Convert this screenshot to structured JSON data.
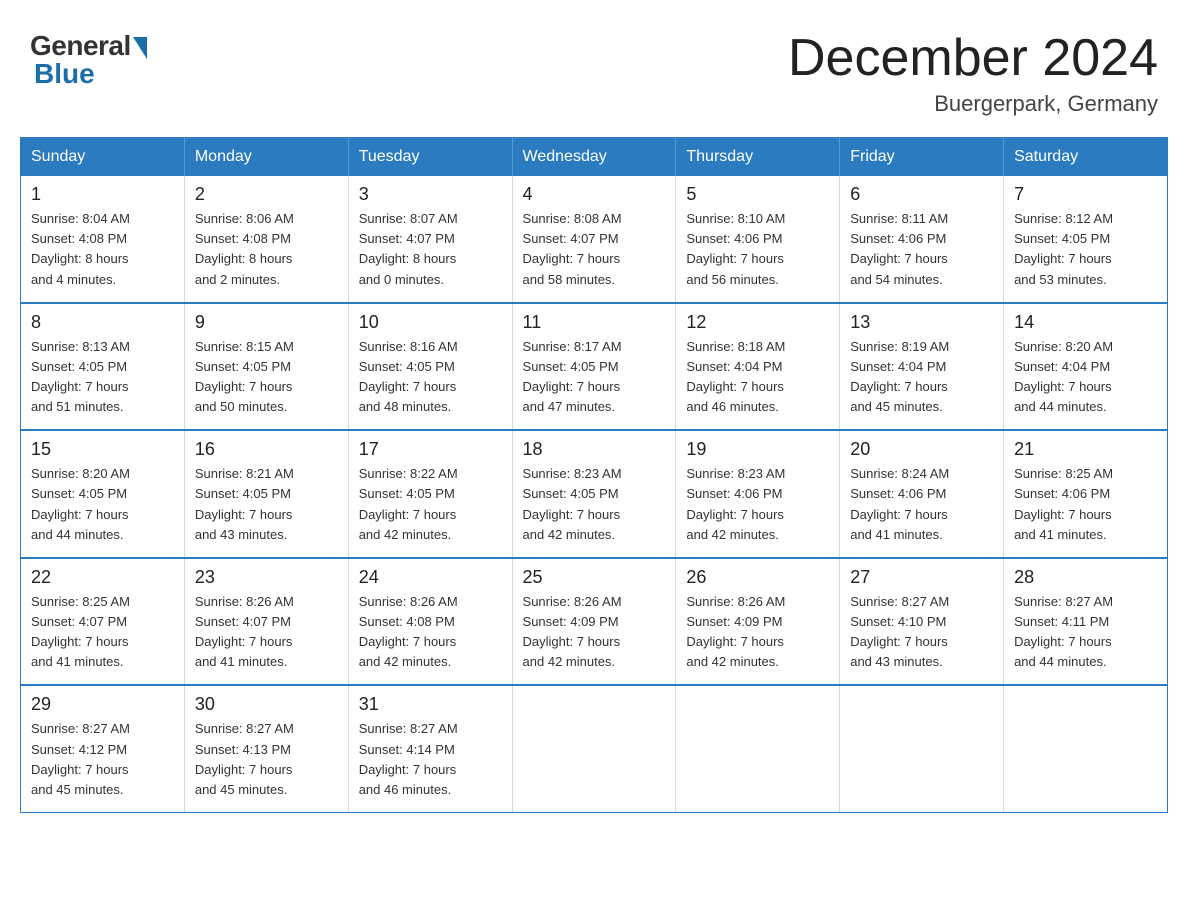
{
  "logo": {
    "text_general": "General",
    "text_blue": "Blue"
  },
  "header": {
    "title": "December 2024",
    "location": "Buergerpark, Germany"
  },
  "weekdays": [
    "Sunday",
    "Monday",
    "Tuesday",
    "Wednesday",
    "Thursday",
    "Friday",
    "Saturday"
  ],
  "weeks": [
    [
      {
        "day": "1",
        "info": "Sunrise: 8:04 AM\nSunset: 4:08 PM\nDaylight: 8 hours\nand 4 minutes."
      },
      {
        "day": "2",
        "info": "Sunrise: 8:06 AM\nSunset: 4:08 PM\nDaylight: 8 hours\nand 2 minutes."
      },
      {
        "day": "3",
        "info": "Sunrise: 8:07 AM\nSunset: 4:07 PM\nDaylight: 8 hours\nand 0 minutes."
      },
      {
        "day": "4",
        "info": "Sunrise: 8:08 AM\nSunset: 4:07 PM\nDaylight: 7 hours\nand 58 minutes."
      },
      {
        "day": "5",
        "info": "Sunrise: 8:10 AM\nSunset: 4:06 PM\nDaylight: 7 hours\nand 56 minutes."
      },
      {
        "day": "6",
        "info": "Sunrise: 8:11 AM\nSunset: 4:06 PM\nDaylight: 7 hours\nand 54 minutes."
      },
      {
        "day": "7",
        "info": "Sunrise: 8:12 AM\nSunset: 4:05 PM\nDaylight: 7 hours\nand 53 minutes."
      }
    ],
    [
      {
        "day": "8",
        "info": "Sunrise: 8:13 AM\nSunset: 4:05 PM\nDaylight: 7 hours\nand 51 minutes."
      },
      {
        "day": "9",
        "info": "Sunrise: 8:15 AM\nSunset: 4:05 PM\nDaylight: 7 hours\nand 50 minutes."
      },
      {
        "day": "10",
        "info": "Sunrise: 8:16 AM\nSunset: 4:05 PM\nDaylight: 7 hours\nand 48 minutes."
      },
      {
        "day": "11",
        "info": "Sunrise: 8:17 AM\nSunset: 4:05 PM\nDaylight: 7 hours\nand 47 minutes."
      },
      {
        "day": "12",
        "info": "Sunrise: 8:18 AM\nSunset: 4:04 PM\nDaylight: 7 hours\nand 46 minutes."
      },
      {
        "day": "13",
        "info": "Sunrise: 8:19 AM\nSunset: 4:04 PM\nDaylight: 7 hours\nand 45 minutes."
      },
      {
        "day": "14",
        "info": "Sunrise: 8:20 AM\nSunset: 4:04 PM\nDaylight: 7 hours\nand 44 minutes."
      }
    ],
    [
      {
        "day": "15",
        "info": "Sunrise: 8:20 AM\nSunset: 4:05 PM\nDaylight: 7 hours\nand 44 minutes."
      },
      {
        "day": "16",
        "info": "Sunrise: 8:21 AM\nSunset: 4:05 PM\nDaylight: 7 hours\nand 43 minutes."
      },
      {
        "day": "17",
        "info": "Sunrise: 8:22 AM\nSunset: 4:05 PM\nDaylight: 7 hours\nand 42 minutes."
      },
      {
        "day": "18",
        "info": "Sunrise: 8:23 AM\nSunset: 4:05 PM\nDaylight: 7 hours\nand 42 minutes."
      },
      {
        "day": "19",
        "info": "Sunrise: 8:23 AM\nSunset: 4:06 PM\nDaylight: 7 hours\nand 42 minutes."
      },
      {
        "day": "20",
        "info": "Sunrise: 8:24 AM\nSunset: 4:06 PM\nDaylight: 7 hours\nand 41 minutes."
      },
      {
        "day": "21",
        "info": "Sunrise: 8:25 AM\nSunset: 4:06 PM\nDaylight: 7 hours\nand 41 minutes."
      }
    ],
    [
      {
        "day": "22",
        "info": "Sunrise: 8:25 AM\nSunset: 4:07 PM\nDaylight: 7 hours\nand 41 minutes."
      },
      {
        "day": "23",
        "info": "Sunrise: 8:26 AM\nSunset: 4:07 PM\nDaylight: 7 hours\nand 41 minutes."
      },
      {
        "day": "24",
        "info": "Sunrise: 8:26 AM\nSunset: 4:08 PM\nDaylight: 7 hours\nand 42 minutes."
      },
      {
        "day": "25",
        "info": "Sunrise: 8:26 AM\nSunset: 4:09 PM\nDaylight: 7 hours\nand 42 minutes."
      },
      {
        "day": "26",
        "info": "Sunrise: 8:26 AM\nSunset: 4:09 PM\nDaylight: 7 hours\nand 42 minutes."
      },
      {
        "day": "27",
        "info": "Sunrise: 8:27 AM\nSunset: 4:10 PM\nDaylight: 7 hours\nand 43 minutes."
      },
      {
        "day": "28",
        "info": "Sunrise: 8:27 AM\nSunset: 4:11 PM\nDaylight: 7 hours\nand 44 minutes."
      }
    ],
    [
      {
        "day": "29",
        "info": "Sunrise: 8:27 AM\nSunset: 4:12 PM\nDaylight: 7 hours\nand 45 minutes."
      },
      {
        "day": "30",
        "info": "Sunrise: 8:27 AM\nSunset: 4:13 PM\nDaylight: 7 hours\nand 45 minutes."
      },
      {
        "day": "31",
        "info": "Sunrise: 8:27 AM\nSunset: 4:14 PM\nDaylight: 7 hours\nand 46 minutes."
      },
      null,
      null,
      null,
      null
    ]
  ]
}
